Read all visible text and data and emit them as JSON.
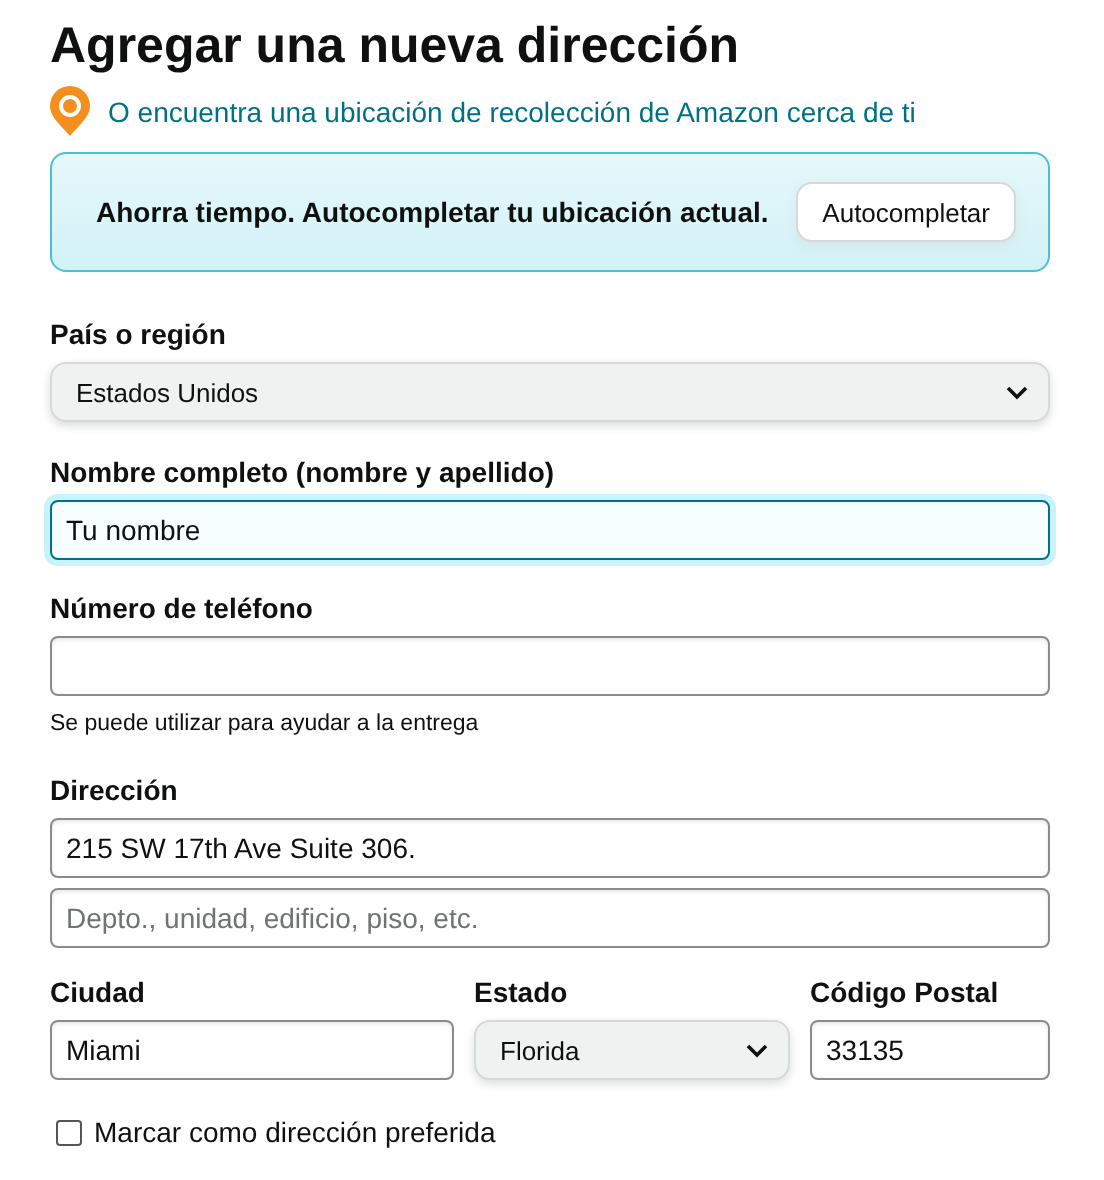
{
  "title": "Agregar una nueva dirección",
  "pickup_link": "O encuentra una ubicación de recolección de Amazon cerca de ti",
  "banner": {
    "text": "Ahorra tiempo. Autocompletar tu ubicación actual.",
    "button": "Autocompletar"
  },
  "fields": [
    {
      "kind": "select",
      "label": "País o región",
      "value": "Estados Unidos"
    },
    {
      "kind": "input",
      "label": "Nombre completo (nombre y apellido)",
      "value": "Tu nombre",
      "focused": true
    },
    {
      "kind": "input",
      "label": "Número de teléfono",
      "hint": "Se puede utilizar para ayudar a la entrega",
      "focused": false
    },
    {
      "kind": "multi",
      "label": "Dirección",
      "inputs": [
        {
          "value": "215 SW 17th Ave Suite 306.",
          "focused": false
        },
        {
          "placeholder": "Depto., unidad, edificio, piso, etc.",
          "focused": false
        }
      ]
    }
  ],
  "row": [
    {
      "kind": "input",
      "label": "Ciudad",
      "value": "Miami",
      "focused": false
    },
    {
      "kind": "select",
      "label": "Estado",
      "value": "Florida"
    },
    {
      "kind": "input",
      "label": "Código Postal",
      "value": "33135",
      "focused": false
    }
  ],
  "checkbox": {
    "label": "Marcar como dirección preferida",
    "checked": false
  }
}
